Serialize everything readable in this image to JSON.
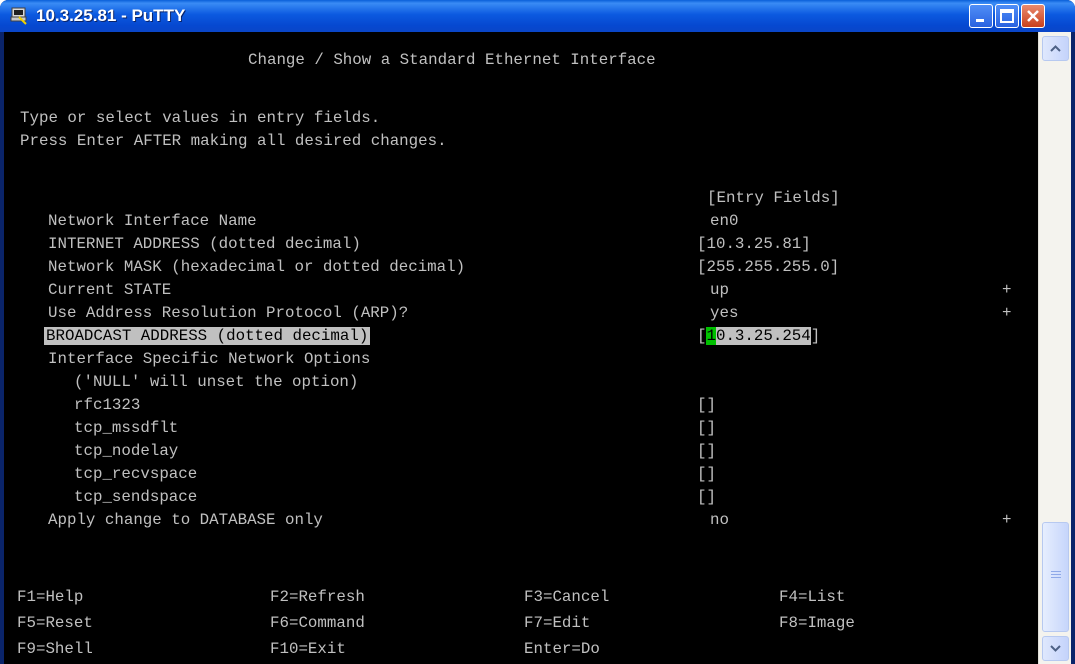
{
  "window": {
    "title": "10.3.25.81 - PuTTY"
  },
  "screen": {
    "header": "Change / Show a Standard Ethernet Interface",
    "instructions": [
      "Type or select values in entry fields.",
      "Press Enter AFTER making all desired changes."
    ],
    "entry_fields_header": "[Entry Fields]",
    "fields": {
      "interface_name": {
        "label": "Network Interface Name",
        "value": "en0"
      },
      "internet_address": {
        "label": "INTERNET ADDRESS (dotted decimal)",
        "value": "[10.3.25.81]"
      },
      "network_mask": {
        "label": "Network MASK (hexadecimal or dotted decimal)",
        "value": "[255.255.255.0]"
      },
      "current_state": {
        "label": "Current STATE",
        "value": "up",
        "marker": "+"
      },
      "use_arp": {
        "label": "Use Address Resolution Protocol (ARP)?",
        "value": "yes",
        "marker": "+"
      },
      "broadcast_address": {
        "label": "BROADCAST ADDRESS (dotted decimal)",
        "open_bracket": "[",
        "cursor_char": "1",
        "value_rest": "0.3.25.254",
        "close_bracket": "]"
      },
      "network_options": {
        "label": "Interface Specific Network Options",
        "note": "('NULL' will unset the option)"
      },
      "rfc1323": {
        "label": "rfc1323",
        "value": "[]"
      },
      "tcp_mssdflt": {
        "label": "tcp_mssdflt",
        "value": "[]"
      },
      "tcp_nodelay": {
        "label": "tcp_nodelay",
        "value": "[]"
      },
      "tcp_recvspace": {
        "label": "tcp_recvspace",
        "value": "[]"
      },
      "tcp_sendspace": {
        "label": "tcp_sendspace",
        "value": "[]"
      },
      "apply_database_only": {
        "label": "Apply change to DATABASE only",
        "value": "no",
        "marker": "+"
      }
    },
    "function_keys": {
      "f1": "F1=Help",
      "f2": "F2=Refresh",
      "f3": "F3=Cancel",
      "f4": "F4=List",
      "f5": "F5=Reset",
      "f6": "F6=Command",
      "f7": "F7=Edit",
      "f8": "F8=Image",
      "f9": "F9=Shell",
      "f10": "F10=Exit",
      "enter": "Enter=Do"
    }
  },
  "icons": {
    "app": "putty-icon",
    "minimize": "minimize-icon",
    "maximize": "maximize-icon",
    "close": "close-icon",
    "scroll_up": "arrow-up-icon",
    "scroll_down": "arrow-down-icon"
  },
  "colors": {
    "terminal_bg": "#000000",
    "terminal_text": "#c0c0c0",
    "highlight_bg": "#c0c0c0",
    "cursor": "#00c000",
    "titlebar": "#0a5fd8"
  }
}
